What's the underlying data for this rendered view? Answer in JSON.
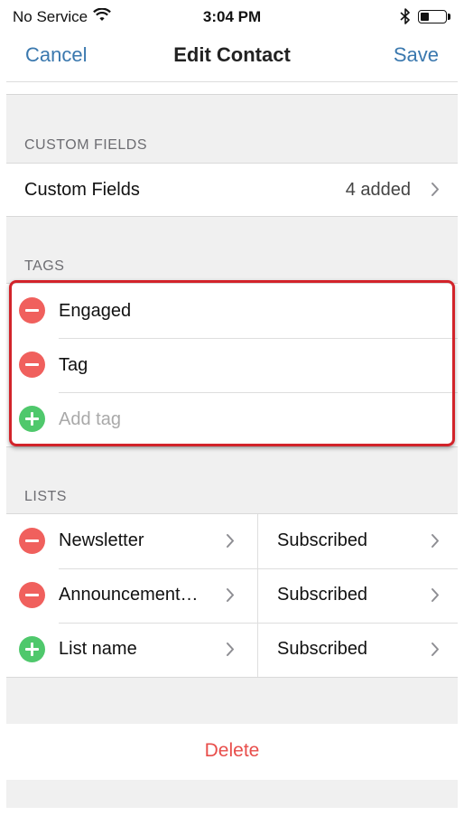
{
  "status_bar": {
    "carrier": "No Service",
    "time": "3:04 PM"
  },
  "nav": {
    "cancel_label": "Cancel",
    "title": "Edit Contact",
    "save_label": "Save"
  },
  "custom_fields_section": {
    "header": "CUSTOM FIELDS",
    "row_label": "Custom Fields",
    "row_value": "4 added"
  },
  "tags_section": {
    "header": "TAGS",
    "items": [
      {
        "label": "Engaged",
        "action": "remove"
      },
      {
        "label": "Tag",
        "action": "remove"
      }
    ],
    "add_placeholder": "Add tag"
  },
  "lists_section": {
    "header": "LISTS",
    "items": [
      {
        "name": "Newsletter",
        "status": "Subscribed",
        "action": "remove"
      },
      {
        "name": "Announcement…",
        "status": "Subscribed",
        "action": "remove"
      }
    ],
    "add_row": {
      "name_placeholder": "List name",
      "status_placeholder": "Subscribed"
    }
  },
  "delete_label": "Delete",
  "colors": {
    "accent": "#3a78ae",
    "remove": "#f0605d",
    "add": "#4fc86c",
    "destructive": "#e84e4b",
    "highlight_border": "#d2232a"
  },
  "icons": {
    "wifi": "wifi-icon",
    "bluetooth": "bluetooth-icon",
    "battery": "battery-icon",
    "chevron": "chevron-right-icon",
    "remove": "minus-circle-icon",
    "add": "plus-circle-icon"
  }
}
